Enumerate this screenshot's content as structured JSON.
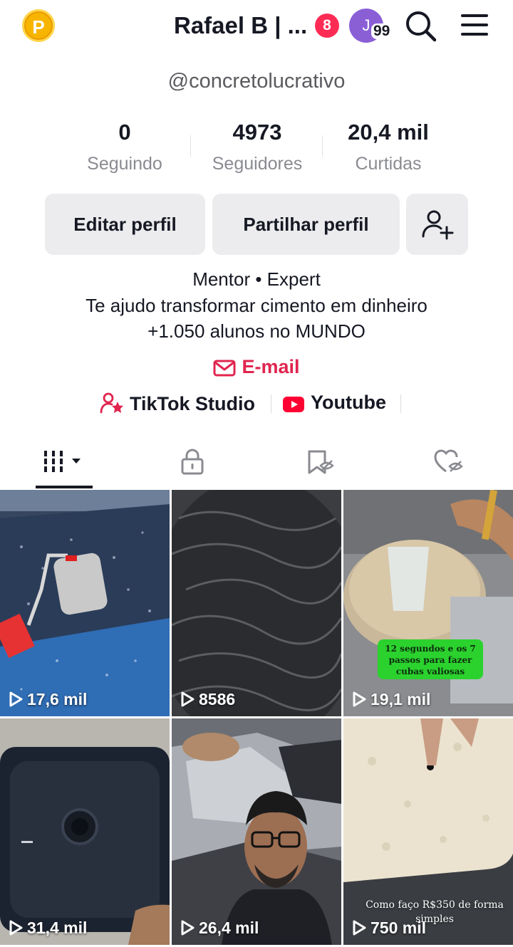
{
  "header": {
    "coin_letter": "P",
    "username": "Rafael B | ...",
    "notification_count": "8",
    "account_initial": "J",
    "account_count": "99"
  },
  "profile": {
    "handle": "@concretolucrativo",
    "stats": [
      {
        "value": "0",
        "label": "Seguindo"
      },
      {
        "value": "4973",
        "label": "Seguidores"
      },
      {
        "value": "20,4 mil",
        "label": "Curtidas"
      }
    ],
    "buttons": {
      "edit": "Editar perfil",
      "share": "Partilhar perfil"
    },
    "bio": [
      "Mentor • Expert",
      "Te ajudo transformar cimento em dinheiro",
      "+1.050 alunos no MUNDO"
    ],
    "email": "E-mail",
    "links": {
      "studio": "TikTok Studio",
      "youtube": "Youtube"
    }
  },
  "tabs": [
    "videos",
    "private",
    "favorites-hidden",
    "liked-hidden"
  ],
  "colors": {
    "accent_red": "#fe2c55",
    "email_red": "#e0254f",
    "button_bg": "#ececee",
    "text": "#161823",
    "secondary_text": "#8a8b91"
  },
  "videos": [
    {
      "views": "17,6 mil",
      "overlay": ""
    },
    {
      "views": "8586",
      "overlay": ""
    },
    {
      "views": "19,1 mil",
      "overlay": "12 segundos e os 7 passos para fazer cubas valiosas"
    },
    {
      "views": "31,4 mil",
      "overlay": ""
    },
    {
      "views": "26,4 mil",
      "overlay": ""
    },
    {
      "views": "750 mil",
      "overlay": "Como faço R$350 de forma simples"
    }
  ]
}
